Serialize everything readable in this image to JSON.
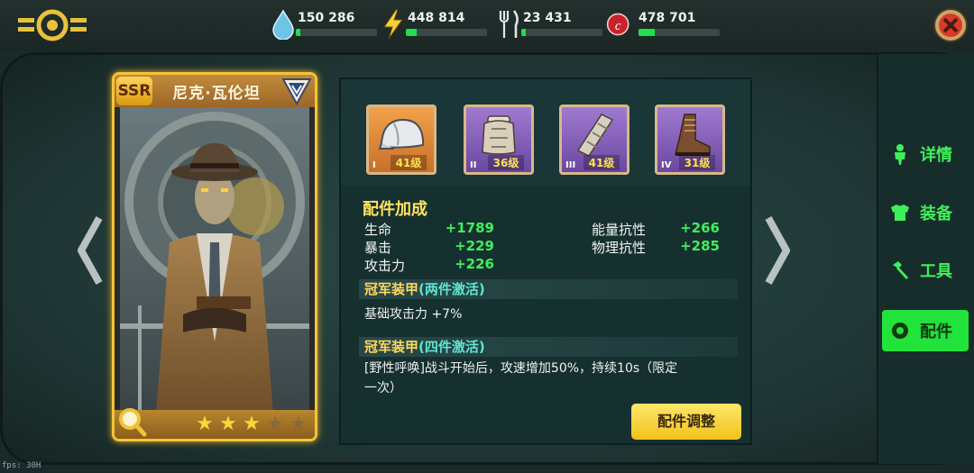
{
  "header": {
    "resources": [
      {
        "name": "water",
        "icon": "water-drop-icon",
        "value": "150 286",
        "fill": 0.05
      },
      {
        "name": "power",
        "icon": "lightning-icon",
        "value": "448 814",
        "fill": 0.13
      },
      {
        "name": "food",
        "icon": "fork-knife-icon",
        "value": "23 431",
        "fill": 0.05
      },
      {
        "name": "caps",
        "icon": "bottle-cap-icon",
        "value": "478 701",
        "fill": 0.2
      }
    ]
  },
  "card": {
    "rarity": "SSR",
    "name": "尼克·瓦伦坦",
    "stars_total": 5,
    "stars_filled": 3
  },
  "equipment_slots": [
    {
      "roman": "I",
      "level": "41级",
      "rarity": "orange",
      "item": "helmet-icon"
    },
    {
      "roman": "II",
      "level": "36级",
      "rarity": "purple",
      "item": "chest-armor-icon"
    },
    {
      "roman": "III",
      "level": "41级",
      "rarity": "purple",
      "item": "leg-armor-icon"
    },
    {
      "roman": "IV",
      "level": "31级",
      "rarity": "purple",
      "item": "boot-icon"
    }
  ],
  "bonus": {
    "title": "配件加成",
    "stats_left": [
      {
        "label": "生命",
        "value": "+1789"
      },
      {
        "label": "暴击",
        "value": "+229"
      },
      {
        "label": "攻击力",
        "value": "+226"
      }
    ],
    "stats_right": [
      {
        "label": "能量抗性",
        "value": "+266"
      },
      {
        "label": "物理抗性",
        "value": "+285"
      }
    ]
  },
  "set_bonus_2": {
    "name": "冠军装甲",
    "condition": "(两件激活)",
    "description": "基础攻击力 +7%"
  },
  "set_bonus_4": {
    "name": "冠军装甲",
    "condition": "(四件激活)",
    "description_line1": "[野性呼唤]战斗开始后，攻速增加50%，持续10s（限定",
    "description_line2": "一次）"
  },
  "adjust_button": "配件调整",
  "nav": {
    "items": [
      {
        "label": "详情",
        "icon": "person-icon",
        "active": false
      },
      {
        "label": "装备",
        "icon": "armor-icon",
        "active": false
      },
      {
        "label": "工具",
        "icon": "hammer-icon",
        "active": false
      },
      {
        "label": "配件",
        "icon": "gear-ring-icon",
        "active": true
      }
    ]
  },
  "fps_text": "fps: 30H",
  "colors": {
    "accent_green": "#3ef05a",
    "gold": "#ffd95a",
    "active_tab": "#22e23c"
  }
}
